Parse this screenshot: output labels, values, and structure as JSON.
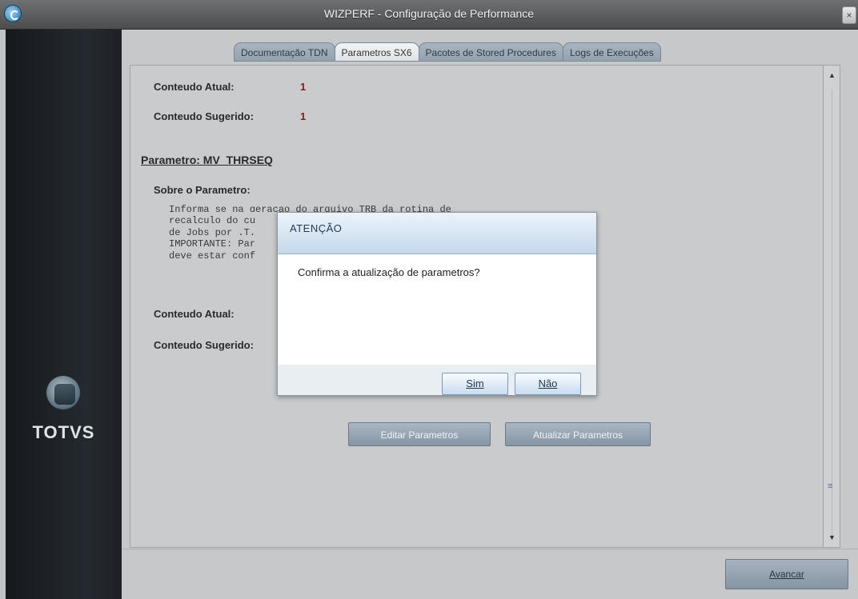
{
  "window": {
    "title": "WIZPERF - Configuração de Performance",
    "close_label": "×"
  },
  "branding": {
    "logo_text": "TOTVS"
  },
  "tabs": [
    {
      "label": "Documentação TDN"
    },
    {
      "label": "Parametros SX6"
    },
    {
      "label": "Pacotes de Stored Procedures"
    },
    {
      "label": "Logs de Execuções"
    }
  ],
  "top_block": {
    "current_label": "Conteudo Atual:",
    "current_value": "1",
    "suggested_label": "Conteudo Sugerido:",
    "suggested_value": "1"
  },
  "param_block": {
    "title": "Parametro: MV_THRSEQ",
    "about_label": "Sobre o Parametro:",
    "description_lines": [
      "Informa se na geracao do arquivo TRB da rotina de",
      "recalculo do cu",
      "de Jobs por .T.",
      "IMPORTANTE: Par",
      "deve estar conf"
    ],
    "current_label": "Conteudo Atual:",
    "suggested_label": "Conteudo Sugerido:"
  },
  "actions": {
    "edit_label": "Editar Parametros",
    "update_label": "Atualizar Parametros"
  },
  "dialog": {
    "title": "ATENÇÃO",
    "message": "Confirma a atualização de parametros?",
    "yes_label": "Sim",
    "no_label": "Não"
  },
  "footer": {
    "advance_label": "Avancar"
  }
}
